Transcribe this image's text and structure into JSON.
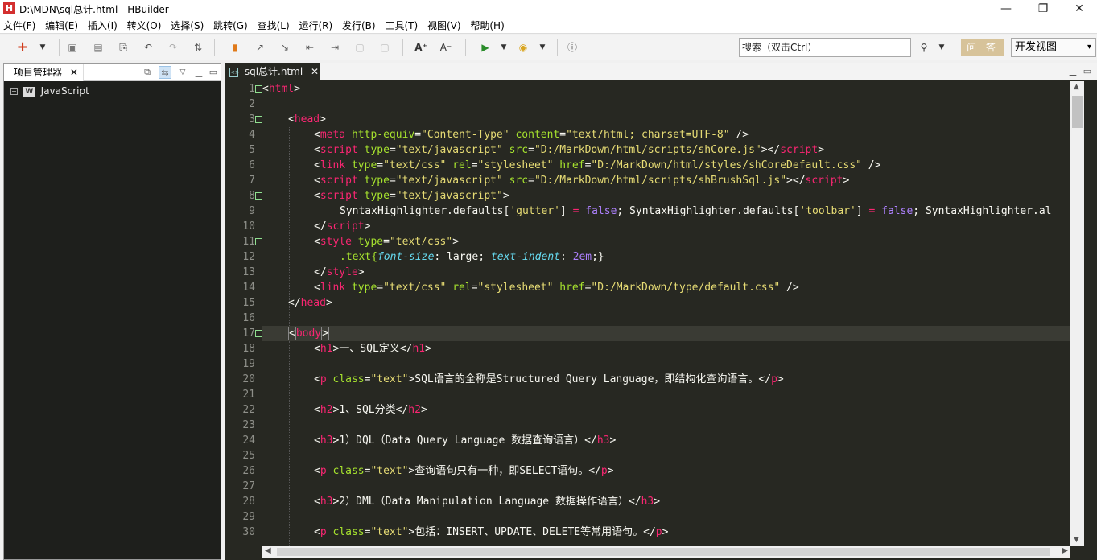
{
  "window": {
    "title": "D:\\MDN\\sql总计.html  -  HBuilder",
    "logo": "H"
  },
  "menu": [
    "文件(F)",
    "编辑(E)",
    "插入(I)",
    "转义(O)",
    "选择(S)",
    "跳转(G)",
    "查找(L)",
    "运行(R)",
    "发行(B)",
    "工具(T)",
    "视图(V)",
    "帮助(H)"
  ],
  "toolbar": {
    "search_placeholder": "搜索（双击Ctrl）",
    "ask_label": "问 答",
    "view_selected": "开发视图"
  },
  "project_panel": {
    "title": "项目管理器",
    "tree_item": "JavaScript"
  },
  "editor": {
    "tab_label": "sql总计.html",
    "line_numbers": [
      "1",
      "2",
      "3",
      "4",
      "5",
      "6",
      "7",
      "8",
      "9",
      "10",
      "11",
      "12",
      "13",
      "14",
      "15",
      "16",
      "17",
      "18",
      "19",
      "20",
      "21",
      "22",
      "23",
      "24",
      "25",
      "26",
      "27",
      "28",
      "29",
      "30"
    ],
    "lines": {
      "l1_a": "<",
      "l1_b": "html",
      "l1_c": ">",
      "l3_a": "<",
      "l3_b": "head",
      "l3_c": ">",
      "l4_a": "<",
      "l4_b": "meta",
      "l4_c": " http-equiv",
      "l4_d": "=",
      "l4_e": "\"Content-Type\"",
      "l4_f": " content",
      "l4_g": "=",
      "l4_h": "\"text/html; charset=UTF-8\"",
      "l4_i": " />",
      "l5_a": "<",
      "l5_b": "script",
      "l5_c": " type",
      "l5_d": "=",
      "l5_e": "\"text/javascript\"",
      "l5_f": " src",
      "l5_g": "=",
      "l5_h": "\"D:/MarkDown/html/scripts/shCore.js\"",
      "l5_i": "></",
      "l5_j": "script",
      "l5_k": ">",
      "l6_a": "<",
      "l6_b": "link",
      "l6_c": " type",
      "l6_d": "=",
      "l6_e": "\"text/css\"",
      "l6_f": " rel",
      "l6_g": "=",
      "l6_h": "\"stylesheet\"",
      "l6_i": " href",
      "l6_j": "=",
      "l6_k": "\"D:/MarkDown/html/styles/shCoreDefault.css\"",
      "l6_l": " />",
      "l7_a": "<",
      "l7_b": "script",
      "l7_c": " type",
      "l7_d": "=",
      "l7_e": "\"text/javascript\"",
      "l7_f": " src",
      "l7_g": "=",
      "l7_h": "\"D:/MarkDown/html/scripts/shBrushSql.js\"",
      "l7_i": "></",
      "l7_j": "script",
      "l7_k": ">",
      "l8_a": "<",
      "l8_b": "script",
      "l8_c": " type",
      "l8_d": "=",
      "l8_e": "\"text/javascript\"",
      "l8_f": ">",
      "l9_a": "SyntaxHighlighter.defaults[",
      "l9_b": "'gutter'",
      "l9_c": "] ",
      "l9_d": "=",
      "l9_e": " ",
      "l9_f": "false",
      "l9_g": "; SyntaxHighlighter.defaults[",
      "l9_h": "'toolbar'",
      "l9_i": "] ",
      "l9_j": "=",
      "l9_k": " ",
      "l9_l": "false",
      "l9_m": "; SyntaxHighlighter.al",
      "l10_a": "</",
      "l10_b": "script",
      "l10_c": ">",
      "l11_a": "<",
      "l11_b": "style",
      "l11_c": " type",
      "l11_d": "=",
      "l11_e": "\"text/css\"",
      "l11_f": ">",
      "l12_a": ".text{",
      "l12_b": "font-size",
      "l12_c": ": large; ",
      "l12_d": "text-indent",
      "l12_e": ": ",
      "l12_f": "2em",
      "l12_g": ";}",
      "l13_a": "</",
      "l13_b": "style",
      "l13_c": ">",
      "l14_a": "<",
      "l14_b": "link",
      "l14_c": " type",
      "l14_d": "=",
      "l14_e": "\"text/css\"",
      "l14_f": " rel",
      "l14_g": "=",
      "l14_h": "\"stylesheet\"",
      "l14_i": " href",
      "l14_j": "=",
      "l14_k": "\"D:/MarkDown/type/default.css\"",
      "l14_l": " />",
      "l15_a": "</",
      "l15_b": "head",
      "l15_c": ">",
      "l17_a": "<",
      "l17_b": "body",
      "l17_c": ">",
      "l18_a": "<",
      "l18_b": "h1",
      "l18_c": ">一、SQL定义</",
      "l18_d": "h1",
      "l18_e": ">",
      "l20_a": "<",
      "l20_b": "p",
      "l20_c": " class",
      "l20_d": "=",
      "l20_e": "\"text\"",
      "l20_f": ">SQL语言的全称是Structured Query Language，即结构化查询语言。</",
      "l20_g": "p",
      "l20_h": ">",
      "l22_a": "<",
      "l22_b": "h2",
      "l22_c": ">1、SQL分类</",
      "l22_d": "h2",
      "l22_e": ">",
      "l24_a": "<",
      "l24_b": "h3",
      "l24_c": ">1）DQL（Data Query Language 数据查询语言）</",
      "l24_d": "h3",
      "l24_e": ">",
      "l26_a": "<",
      "l26_b": "p",
      "l26_c": " class",
      "l26_d": "=",
      "l26_e": "\"text\"",
      "l26_f": ">查询语句只有一种，即SELECT语句。</",
      "l26_g": "p",
      "l26_h": ">",
      "l28_a": "<",
      "l28_b": "h3",
      "l28_c": ">2）DML（Data Manipulation Language 数据操作语言）</",
      "l28_d": "h3",
      "l28_e": ">",
      "l30_a": "<",
      "l30_b": "p",
      "l30_c": " class",
      "l30_d": "=",
      "l30_e": "\"text\"",
      "l30_f": ">包括：INSERT、UPDATE、DELETE等常用语句。</",
      "l30_g": "p",
      "l30_h": ">"
    }
  },
  "colors": {
    "editor_bg": "#272822",
    "tag": "#f92672",
    "attr": "#a6e22e",
    "string": "#e6db74",
    "keyword": "#ae81ff",
    "css_prop": "#66d9ef",
    "ask_button": "#d7c39a"
  }
}
